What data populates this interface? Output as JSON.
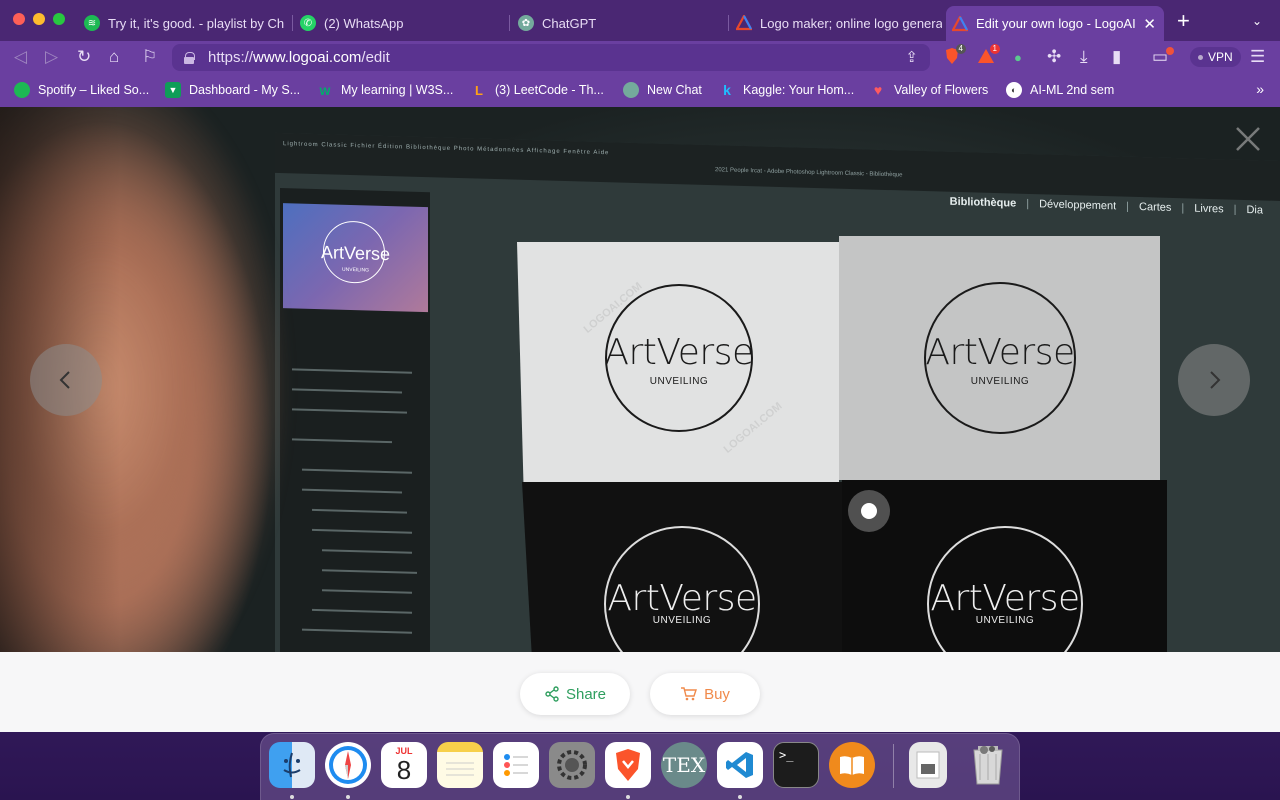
{
  "browser": {
    "tabs": [
      {
        "label": "Try it, it's good. - playlist by Ch",
        "icon": "spotify-icon",
        "color": "#1db954"
      },
      {
        "label": "(2) WhatsApp",
        "icon": "whatsapp-icon",
        "color": "#25d366"
      },
      {
        "label": "ChatGPT",
        "icon": "chatgpt-icon",
        "color": "#74aa9c"
      },
      {
        "label": "Logo maker; online logo generat",
        "icon": "logoai-icon",
        "color": "#e8482b"
      },
      {
        "label": "Edit your own logo - LogoAI",
        "icon": "logoai-icon",
        "color": "#e8482b",
        "active": true
      }
    ],
    "url_prefix": "https://",
    "url_domain": "www.logoai.com",
    "url_path": "/edit",
    "brave_shield_count": "4",
    "rewards_count": "1",
    "vpn_label": "VPN"
  },
  "bookmarks": [
    {
      "label": "Spotify – Liked So...",
      "color": "#1db954",
      "glyph": ""
    },
    {
      "label": "Dashboard - My S...",
      "color": "#0f9d58",
      "glyph": "▼"
    },
    {
      "label": "My learning | W3S...",
      "color": "#04aa6d",
      "glyph": "w"
    },
    {
      "label": "(3) LeetCode - Th...",
      "color": "#ffa116",
      "glyph": "L"
    },
    {
      "label": "New Chat",
      "color": "#74aa9c",
      "glyph": ""
    },
    {
      "label": "Kaggle: Your Hom...",
      "color": "#20beff",
      "glyph": "k"
    },
    {
      "label": "Valley of Flowers",
      "color": "#ff5a5f",
      "glyph": "♥"
    },
    {
      "label": "AI-ML 2nd sem",
      "color": "#ffffff",
      "glyph": "◐"
    }
  ],
  "preview": {
    "monitor_menu": "Lightroom Classic   Fichier   Édition   Bibliothèque   Photo   Métadonnées   Affichage   Fenêtre   Aide",
    "monitor_title": "2021 People Ircat - Adobe Photoshop Lightroom Classic - Bibliothèque",
    "modules": [
      "Bibliothèque",
      "Développement",
      "Cartes",
      "Livres",
      "Dia"
    ],
    "logo_name": "ArtVerse",
    "logo_tagline": "UNVEILING",
    "watermark": "LOGOAI.COM"
  },
  "actions": {
    "share_label": "Share",
    "buy_label": "Buy",
    "share_color": "#2e9e5e",
    "buy_color": "#f08a4b"
  },
  "dock": {
    "apps": [
      "finder-icon",
      "safari-icon",
      "calendar-icon",
      "notes-icon",
      "reminders-icon",
      "system-preferences-icon",
      "brave-icon",
      "tex-icon",
      "vscode-icon",
      "terminal-icon",
      "books-icon",
      "preview-doc-icon",
      "trash-icon"
    ],
    "calendar_month": "JUL",
    "calendar_day": "8",
    "tex_label": "TEX",
    "terminal_prompt": ">_"
  }
}
